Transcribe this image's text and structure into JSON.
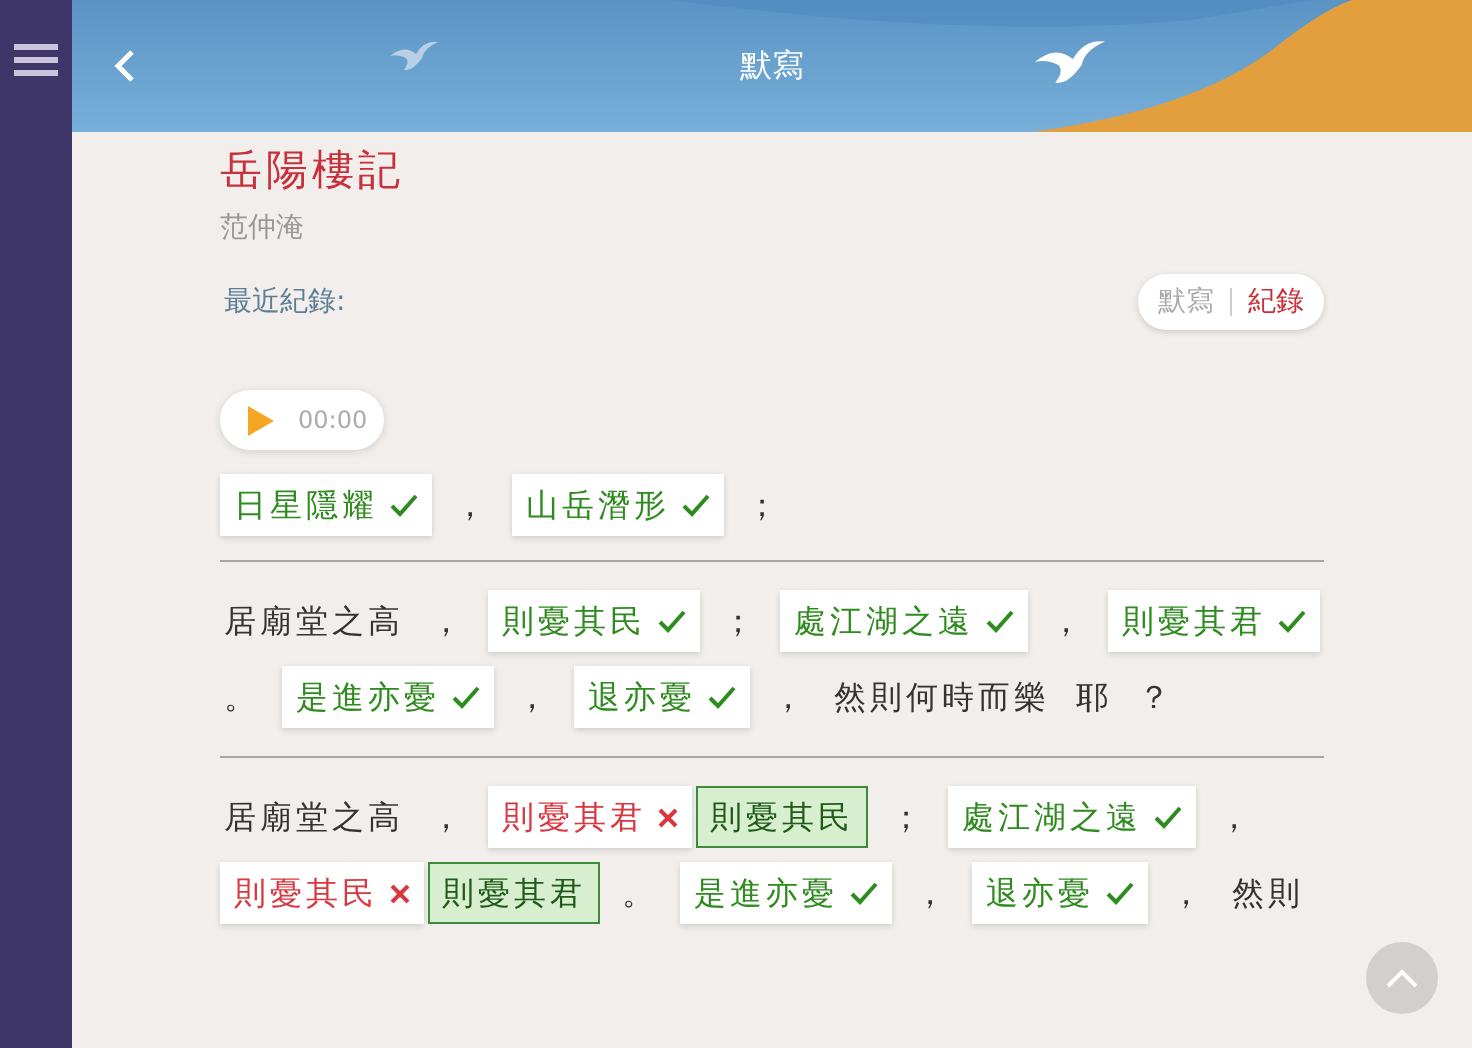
{
  "header": {
    "title": "默寫"
  },
  "poem": {
    "title": "岳陽樓記",
    "author": "范仲淹"
  },
  "recent_label": "最近紀錄:",
  "mode_toggle": [
    {
      "label": "默寫",
      "selected": false
    },
    {
      "label": "紀錄",
      "selected": true
    }
  ],
  "audio": {
    "time": "00:00"
  },
  "records": [
    {
      "segments": [
        {
          "kind": "answer",
          "text": "日星隱耀",
          "correct": true
        },
        {
          "kind": "text",
          "text": "，"
        },
        {
          "kind": "answer",
          "text": "山岳潛形",
          "correct": true
        },
        {
          "kind": "text",
          "text": "；"
        }
      ]
    },
    {
      "segments": [
        {
          "kind": "text",
          "text": "居廟堂之高"
        },
        {
          "kind": "text",
          "text": "，"
        },
        {
          "kind": "answer",
          "text": "則憂其民",
          "correct": true
        },
        {
          "kind": "text",
          "text": "；"
        },
        {
          "kind": "answer",
          "text": "處江湖之遠",
          "correct": true
        },
        {
          "kind": "text",
          "text": "，"
        },
        {
          "kind": "answer",
          "text": "則憂其君",
          "correct": true
        },
        {
          "kind": "text",
          "text": "。"
        },
        {
          "kind": "answer",
          "text": "是進亦憂",
          "correct": true
        },
        {
          "kind": "text",
          "text": "，"
        },
        {
          "kind": "answer",
          "text": "退亦憂",
          "correct": true
        },
        {
          "kind": "text",
          "text": "，"
        },
        {
          "kind": "text",
          "text": "然則何時而樂"
        },
        {
          "kind": "text",
          "text": "耶"
        },
        {
          "kind": "text",
          "text": "？"
        }
      ]
    },
    {
      "segments": [
        {
          "kind": "text",
          "text": "居廟堂之高"
        },
        {
          "kind": "text",
          "text": "，"
        },
        {
          "kind": "answer",
          "text": "則憂其君",
          "correct": false
        },
        {
          "kind": "correction",
          "text": "則憂其民"
        },
        {
          "kind": "text",
          "text": "；"
        },
        {
          "kind": "answer",
          "text": "處江湖之遠",
          "correct": true
        },
        {
          "kind": "text",
          "text": "，"
        },
        {
          "kind": "answer",
          "text": "則憂其民",
          "correct": false
        },
        {
          "kind": "correction",
          "text": "則憂其君"
        },
        {
          "kind": "text",
          "text": "。"
        },
        {
          "kind": "answer",
          "text": "是進亦憂",
          "correct": true
        },
        {
          "kind": "text",
          "text": "，"
        },
        {
          "kind": "answer",
          "text": "退亦憂",
          "correct": true
        },
        {
          "kind": "text",
          "text": "，"
        },
        {
          "kind": "text",
          "text": "然則"
        }
      ]
    }
  ]
}
